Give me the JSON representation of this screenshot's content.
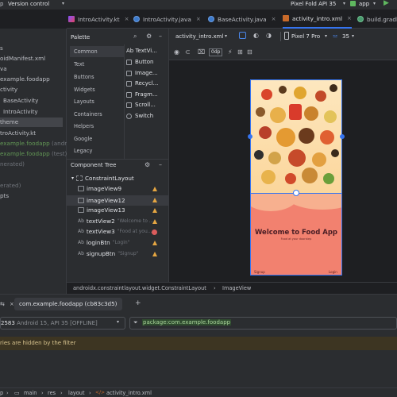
{
  "topbar": {
    "left_partial": "p",
    "vcs": "Version control",
    "device": "Pixel Fold API 35",
    "run_config": "app"
  },
  "tabs": [
    {
      "label": "IntroActivity.kt"
    },
    {
      "label": "IntroActivity.java"
    },
    {
      "label": "BaseActivity.java"
    },
    {
      "label": "activity_intro.xml"
    },
    {
      "label": "build.gradle"
    }
  ],
  "project_tree": [
    {
      "label": "s",
      "style": "normal"
    },
    {
      "label": "oidManifest.xml",
      "style": "normal"
    },
    {
      "label": "va",
      "style": "normal"
    },
    {
      "label": "example.foodapp",
      "style": "normal"
    },
    {
      "label": "ctivity",
      "style": "normal"
    },
    {
      "label": "BaseActivity",
      "style": "normal"
    },
    {
      "label": "IntroActivity",
      "style": "normal"
    },
    {
      "label": "theme",
      "style": "sel"
    },
    {
      "label": "troActivity.kt",
      "style": "normal"
    },
    {
      "label": "example.foodapp",
      "suffix": "(androi",
      "style": "green"
    },
    {
      "label": "example.foodapp",
      "suffix": "(test)",
      "style": "green"
    },
    {
      "label": "nerated)",
      "style": "dim"
    },
    {
      "label": "erated)",
      "style": "dim"
    },
    {
      "label": "pts",
      "style": "normal"
    }
  ],
  "palette": {
    "title": "Palette",
    "categories": [
      "Common",
      "Text",
      "Buttons",
      "Widgets",
      "Layouts",
      "Containers",
      "Helpers",
      "Google",
      "Legacy"
    ],
    "items": [
      "Ab TextVi...",
      "Button",
      "Image...",
      "Recycl...",
      "Fragm...",
      "Scroll...",
      "Switch"
    ]
  },
  "component_tree": {
    "title": "Component Tree",
    "nodes": [
      {
        "label": "ConstraintLayout",
        "hint": "",
        "status": ""
      },
      {
        "label": "imageView9",
        "hint": "",
        "status": "warn"
      },
      {
        "label": "imageView12",
        "hint": "",
        "status": "warn"
      },
      {
        "label": "imageView13",
        "hint": "",
        "status": "warn"
      },
      {
        "label": "textView2",
        "hint": "\"Welcome to ...",
        "status": "warn"
      },
      {
        "label": "textView3",
        "hint": "\"Food at you...",
        "status": "err"
      },
      {
        "label": "loginBtn",
        "hint": "\"Login\"",
        "status": "warn"
      },
      {
        "label": "signupBtn",
        "hint": "\"Signup\"",
        "status": "warn"
      }
    ]
  },
  "editor": {
    "file": "activity_intro.xml",
    "device": "Pixel 7 Pro",
    "api": "35",
    "dp": "0dp"
  },
  "preview": {
    "title": "Welcome to Food App",
    "subtitle": "Food at your doorstep",
    "signup": "Signup",
    "login": "Login"
  },
  "breadcrumb": {
    "path1": "androidx.constraintlayout.widget.ConstraintLayout",
    "path2": "ImageView"
  },
  "logcat": {
    "process": "com.example.foodapp (cb83c3d5)",
    "device": "2583",
    "device_info": "Android 15, API 35 [OFFLINE]",
    "filter": "package:com.example.foodapp",
    "notice": "ries are hidden by the filter"
  },
  "statusbar": {
    "p1": "p",
    "p2": "main",
    "p3": "res",
    "p4": "layout",
    "p5": "activity_intro.xml"
  }
}
